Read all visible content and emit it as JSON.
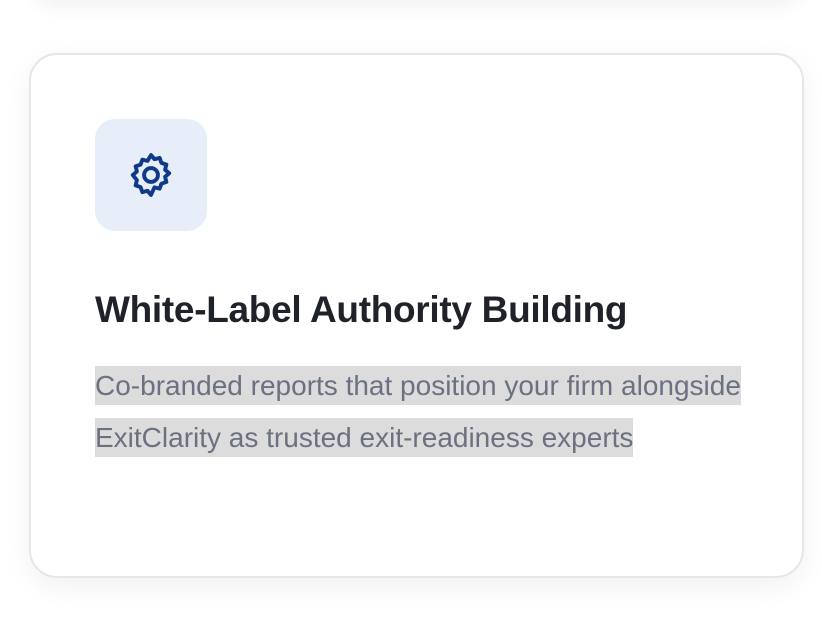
{
  "card": {
    "icon": "gear-icon",
    "title": "White-Label Authority Building",
    "description": "Co-branded reports that position your firm alongside ExitClarity as trusted exit-readiness experts"
  },
  "colors": {
    "icon_stroke": "#0f3a8a",
    "icon_tile_bg": "#e8eef9",
    "title_text": "#1f2329",
    "description_text": "#6b7180",
    "selection_highlight": "#dcdcdc",
    "card_border": "#e3e6ea"
  }
}
